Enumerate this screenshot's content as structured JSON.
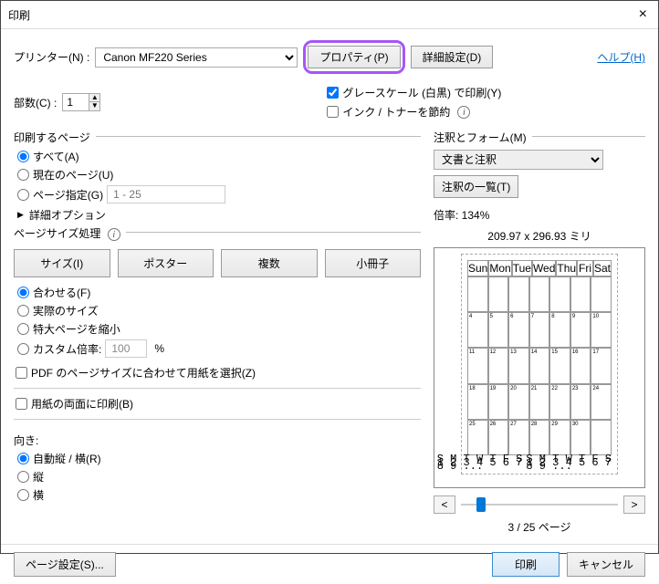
{
  "window": {
    "title": "印刷"
  },
  "top": {
    "printer_label": "プリンター(N) :",
    "printer_value": "Canon MF220 Series",
    "properties_btn": "プロパティ(P)",
    "advanced_btn": "詳細設定(D)",
    "help_link": "ヘルプ(H)"
  },
  "copies": {
    "label": "部数(C) :",
    "value": "1"
  },
  "options": {
    "grayscale_label": "グレースケール (白黒) で印刷(Y)",
    "grayscale_checked": true,
    "ink_saver_label": "インク / トナーを節約"
  },
  "pages": {
    "legend": "印刷するページ",
    "all": "すべて(A)",
    "current": "現在のページ(U)",
    "range_label": "ページ指定(G)",
    "range_placeholder": "1 - 25",
    "more": "詳細オプション"
  },
  "sizing": {
    "legend": "ページサイズ処理",
    "size_btn": "サイズ(I)",
    "poster_btn": "ポスター",
    "multi_btn": "複数",
    "booklet_btn": "小冊子",
    "fit": "合わせる(F)",
    "actual": "実際のサイズ",
    "shrink": "特大ページを縮小",
    "custom_label": "カスタム倍率:",
    "custom_value": "100",
    "custom_unit": "%",
    "choose_paper": "PDF のページサイズに合わせて用紙を選択(Z)"
  },
  "duplex": {
    "label": "用紙の両面に印刷(B)"
  },
  "orientation": {
    "legend": "向き:",
    "auto": "自動縦 / 横(R)",
    "portrait": "縦",
    "landscape": "横"
  },
  "annot": {
    "legend": "注釈とフォーム(M)",
    "value": "文書と注釈",
    "list_btn": "注釈の一覧(T)"
  },
  "preview": {
    "scale_label": "倍率: 134%",
    "dimensions": "209.97 x 296.93 ミリ",
    "page_indicator": "3 / 25 ページ",
    "cal_days": [
      "Sun",
      "Mon",
      "Tue",
      "Wed",
      "Thu",
      "Fri",
      "Sat"
    ],
    "cal_weeks": [
      [
        "",
        "",
        "",
        "",
        "",
        "",
        ""
      ],
      [
        "4",
        "5",
        "6",
        "7",
        "8",
        "9",
        "10"
      ],
      [
        "11",
        "12",
        "13",
        "14",
        "15",
        "16",
        "17"
      ],
      [
        "18",
        "19",
        "20",
        "21",
        "22",
        "23",
        "24"
      ],
      [
        "25",
        "26",
        "27",
        "28",
        "29",
        "30",
        ""
      ]
    ]
  },
  "footer": {
    "page_setup": "ページ設定(S)...",
    "print": "印刷",
    "cancel": "キャンセル"
  }
}
